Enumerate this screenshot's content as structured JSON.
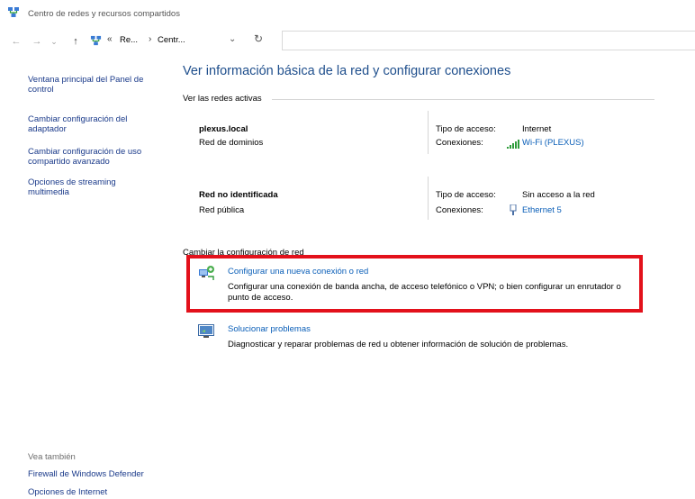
{
  "window": {
    "title": "Centro de redes y recursos compartidos"
  },
  "address": {
    "back": "←",
    "forward": "→",
    "recent": "⌄",
    "up": "↑",
    "chevron": "«",
    "crumbs": [
      "Re...",
      "Centr..."
    ],
    "separator": "›",
    "dropdown": "⌄",
    "refresh": "↻"
  },
  "sidebar": {
    "items": [
      "Ventana principal del Panel de control",
      "Cambiar configuración del adaptador",
      "Cambiar configuración de uso compartido avanzado",
      "Opciones de streaming multimedia"
    ],
    "see_also_label": "Vea también",
    "see_also": [
      "Firewall de Windows Defender",
      "Opciones de Internet"
    ]
  },
  "main": {
    "title": "Ver información básica de la red y configurar conexiones",
    "active_networks_label": "Ver las redes activas",
    "access_label": "Tipo de acceso:",
    "connections_label": "Conexiones:",
    "networks": [
      {
        "name": "plexus.local",
        "type": "Red de dominios",
        "access": "Internet",
        "connection": "Wi-Fi (PLEXUS)"
      },
      {
        "name": "Red no identificada",
        "type": "Red pública",
        "access": "Sin acceso a la red",
        "connection": "Ethernet 5"
      }
    ],
    "change_label": "Cambiar la configuración de red",
    "tasks": [
      {
        "title": "Configurar una nueva conexión o red",
        "desc": "Configurar una conexión de banda ancha, de acceso telefónico o VPN; o bien configurar un enrutador o punto de acceso."
      },
      {
        "title": "Solucionar problemas",
        "desc": "Diagnosticar y reparar problemas de red u obtener información de solución de problemas."
      }
    ]
  },
  "colors": {
    "link": "#0b5fb8",
    "title": "#1e4e8c",
    "highlight": "#e3111b"
  }
}
